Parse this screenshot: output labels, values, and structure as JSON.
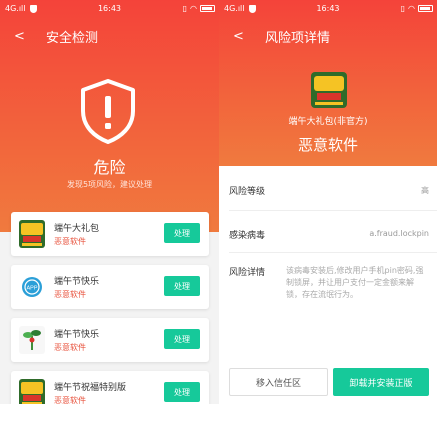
{
  "status_bar": {
    "network": "4G.ıll",
    "time": "16:43"
  },
  "left_screen": {
    "title": "安全检测",
    "danger_title": "危险",
    "danger_subtitle": "发现5项风险，建议处理",
    "apps": [
      {
        "name": "端午大礼包",
        "tag": "恶意软件",
        "action": "处理",
        "icon": "game-gift-icon"
      },
      {
        "name": "端午节快乐",
        "tag": "恶意软件",
        "action": "处理",
        "icon": "app-icon"
      },
      {
        "name": "端午节快乐",
        "tag": "恶意软件",
        "action": "处理",
        "icon": "plant-icon"
      },
      {
        "name": "端午节祝福特别版",
        "tag": "恶意软件",
        "action": "处理",
        "icon": "game-gift-icon"
      }
    ]
  },
  "right_screen": {
    "title": "风险项详情",
    "app_name": "端午大礼包(非官方)",
    "app_kind": "恶意软件",
    "risk_level_label": "风险等级",
    "risk_level_value": "高",
    "virus_label": "感染病毒",
    "virus_value": "a.fraud.lockpin",
    "detail_label": "风险详情",
    "detail_text": "该病毒安装后,修改用户手机pin密码,强制锁屏，并让用户支付一定金额来解锁，存在流氓行为。",
    "trust_button": "移入信任区",
    "uninstall_button": "卸载并安装正版"
  },
  "colors": {
    "header_red": "#f4433a",
    "header_orange": "#f07a3e",
    "action_green": "#16c99a",
    "malware_red": "#e8533e"
  }
}
